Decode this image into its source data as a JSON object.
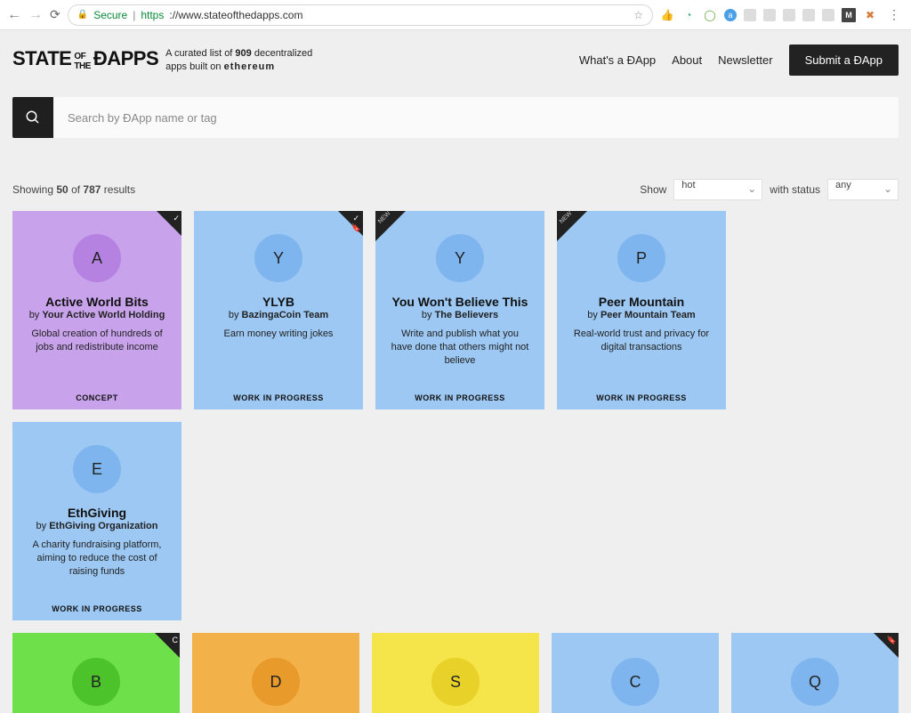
{
  "browser": {
    "secure_label": "Secure",
    "protocol": "https",
    "url": "://www.stateofthedapps.com"
  },
  "header": {
    "logo_main": "STATE",
    "logo_of": "OF",
    "logo_the": "THE",
    "logo_dapps": "ÐAPPS",
    "tagline_pre": "A curated list of ",
    "tagline_count": "909",
    "tagline_mid": " decentralized apps built on ",
    "tagline_platform": "ethereum",
    "nav": {
      "what": "What's a ÐApp",
      "about": "About",
      "newsletter": "Newsletter",
      "submit": "Submit a ÐApp"
    }
  },
  "search": {
    "placeholder": "Search by ÐApp name or tag"
  },
  "stats": {
    "showing_pre": "Showing ",
    "showing_n": "50",
    "showing_of": " of ",
    "total": "787",
    "suffix": " results",
    "show_label": "Show",
    "sort_value": "hot",
    "status_label": "with status",
    "status_value": "any"
  },
  "cards": [
    {
      "letter": "A",
      "title": "Active World Bits",
      "author": "Your Active World Holding",
      "desc": "Global creation of hundreds of jobs and redistribute income",
      "status": "CONCEPT",
      "badge": "check",
      "theme": "purple"
    },
    {
      "letter": "Y",
      "title": "YLYB",
      "author": "BazingaCoin Team",
      "desc": "Earn money writing jokes",
      "status": "WORK IN PROGRESS",
      "badge": "checkmark",
      "theme": "blue"
    },
    {
      "letter": "Y",
      "title": "You Won't Believe This",
      "author": "The Believers",
      "desc": "Write and publish what you have done that others might not believe",
      "status": "WORK IN PROGRESS",
      "badge": "new",
      "theme": "blue"
    },
    {
      "letter": "P",
      "title": "Peer Mountain",
      "author": "Peer Mountain Team",
      "desc": "Real-world trust and privacy for digital transactions",
      "status": "WORK IN PROGRESS",
      "badge": "new",
      "theme": "blue"
    },
    {
      "letter": "E",
      "title": "EthGiving",
      "author": "EthGiving Organization",
      "desc": "A charity fundraising platform, aiming to reduce the cost of raising funds",
      "status": "WORK IN PROGRESS",
      "badge": "",
      "theme": "blue"
    }
  ],
  "cards_row2": [
    {
      "letter": "B",
      "theme": "green",
      "badge": "c"
    },
    {
      "letter": "D",
      "theme": "orange"
    },
    {
      "letter": "S",
      "theme": "yellow"
    },
    {
      "letter": "C",
      "theme": "blue2"
    },
    {
      "letter": "Q",
      "theme": "blue2",
      "badge": "mark"
    }
  ],
  "labels": {
    "by": "by",
    "new": "NEW"
  }
}
